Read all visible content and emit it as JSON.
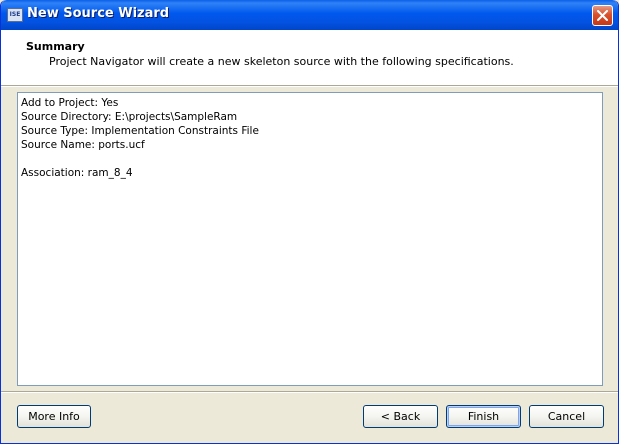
{
  "window": {
    "title": "New Source Wizard",
    "app_icon": "ise-app-icon"
  },
  "header": {
    "title": "Summary",
    "subtitle": "Project Navigator will create a new skeleton source with the following specifications."
  },
  "summary": {
    "lines": [
      "Add to Project: Yes",
      "Source Directory: E:\\projects\\SampleRam",
      "Source Type: Implementation Constraints File",
      "Source Name: ports.ucf",
      "",
      "Association: ram_8_4"
    ]
  },
  "buttons": {
    "more_info": "More Info",
    "back": "< Back",
    "finish": "Finish",
    "cancel": "Cancel"
  },
  "colors": {
    "titlebar": "#0058ee",
    "close_button": "#d9512c",
    "dialog_bg": "#ece9d8"
  }
}
